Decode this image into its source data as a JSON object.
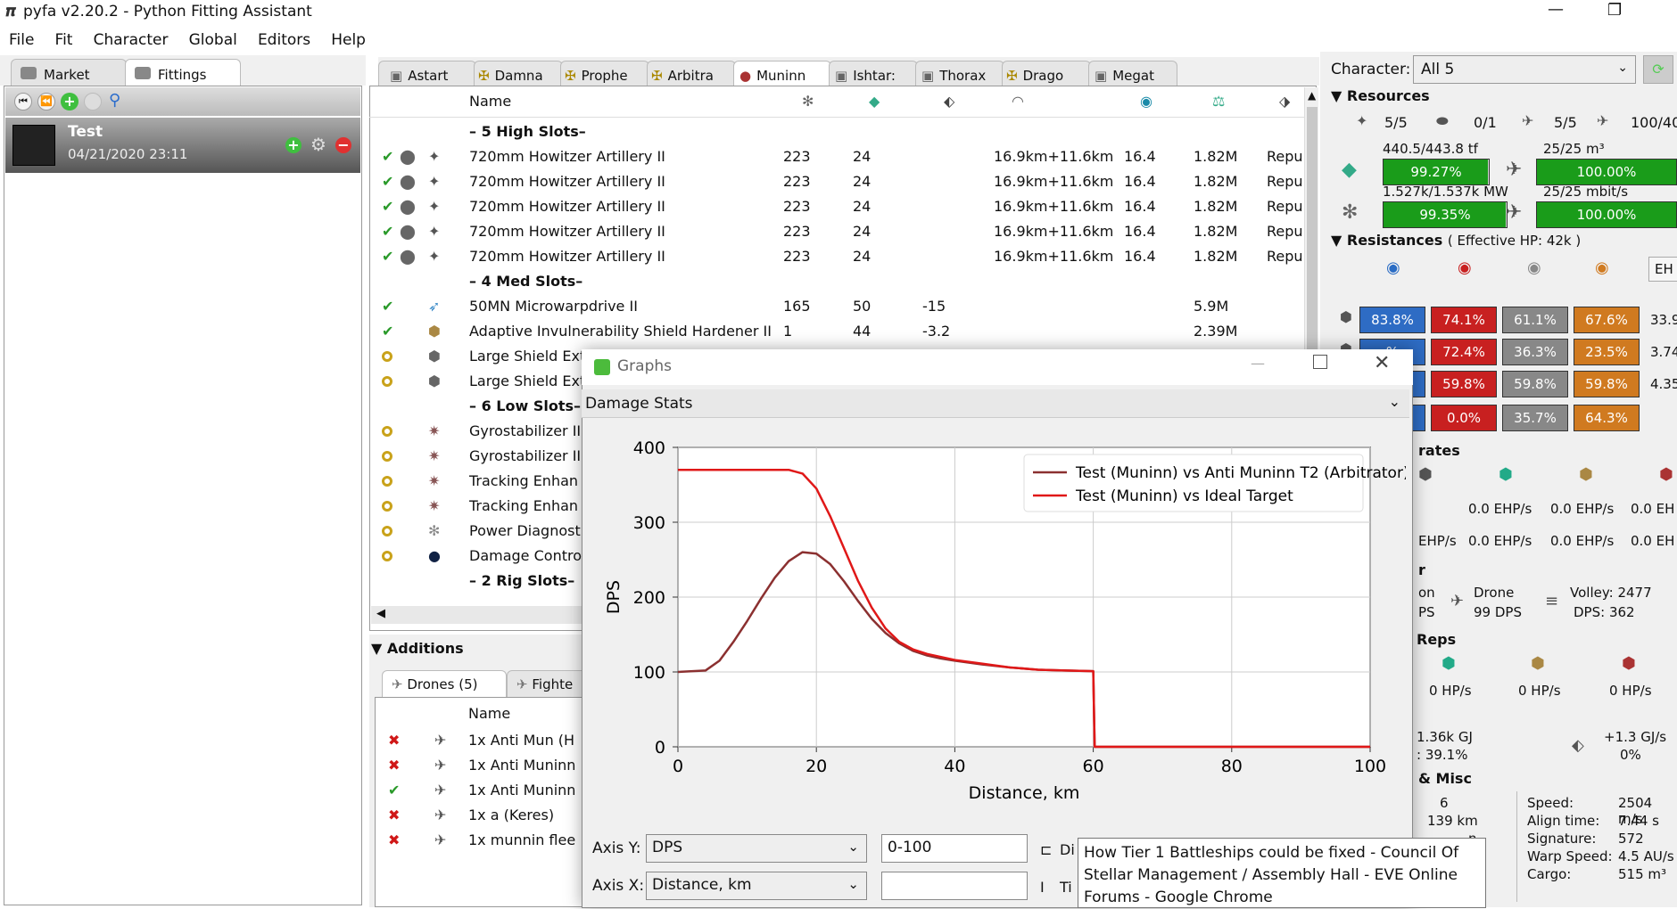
{
  "window": {
    "title": "pyfa v2.20.2 - Python Fitting Assistant"
  },
  "menu": [
    "File",
    "Fit",
    "Character",
    "Global",
    "Editors",
    "Help"
  ],
  "left_tabs": [
    "Market",
    "Fittings"
  ],
  "fit": {
    "name": "Test",
    "date": "04/21/2020 23:11"
  },
  "fit_tabs": [
    "Astart",
    "Damna",
    "Prophe",
    "Arbitra",
    "Muninn",
    "Ishtar:",
    "Thorax",
    "Drago",
    "Megat"
  ],
  "module_header": {
    "name": "Name"
  },
  "sections": {
    "high": "– 5 High Slots–",
    "med": "– 4 Med Slots–",
    "low": "– 6 Low Slots–",
    "rig": "– 2 Rig Slots–"
  },
  "high_modules": [
    {
      "name": "720mm Howitzer Artillery II",
      "c1": "223",
      "c2": "24",
      "range": "16.9km+11.6km",
      "c4": "16.4",
      "price": "1.82M",
      "extra": "Repu"
    },
    {
      "name": "720mm Howitzer Artillery II",
      "c1": "223",
      "c2": "24",
      "range": "16.9km+11.6km",
      "c4": "16.4",
      "price": "1.82M",
      "extra": "Repu"
    },
    {
      "name": "720mm Howitzer Artillery II",
      "c1": "223",
      "c2": "24",
      "range": "16.9km+11.6km",
      "c4": "16.4",
      "price": "1.82M",
      "extra": "Repu"
    },
    {
      "name": "720mm Howitzer Artillery II",
      "c1": "223",
      "c2": "24",
      "range": "16.9km+11.6km",
      "c4": "16.4",
      "price": "1.82M",
      "extra": "Repu"
    },
    {
      "name": "720mm Howitzer Artillery II",
      "c1": "223",
      "c2": "24",
      "range": "16.9km+11.6km",
      "c4": "16.4",
      "price": "1.82M",
      "extra": "Repu"
    }
  ],
  "med_modules": [
    {
      "name": "50MN Microwarpdrive II",
      "c1": "165",
      "c2": "50",
      "c3": "-15",
      "price": "5.9M"
    },
    {
      "name": "Adaptive Invulnerability Shield Hardener II",
      "c1": "1",
      "c2": "44",
      "c3": "-3.2",
      "price": "2.39M"
    },
    {
      "name": "Large Shield Ext"
    },
    {
      "name": "Large Shield Ext"
    }
  ],
  "low_modules": [
    "Gyrostabilizer II",
    "Gyrostabilizer II",
    "Tracking Enhan",
    "Tracking Enhan",
    "Power Diagnost",
    "Damage Contro"
  ],
  "additions": {
    "title": "Additions",
    "tabs": [
      "Drones (5)",
      "Fighte"
    ],
    "header": "Name",
    "items": [
      {
        "status": "x",
        "name": "1x Anti Mun (H"
      },
      {
        "status": "x",
        "name": "1x Anti Muninn"
      },
      {
        "status": "ok",
        "name": "1x Anti Muninn"
      },
      {
        "status": "x",
        "name": "1x a (Keres)"
      },
      {
        "status": "x",
        "name": "1x munnin flee"
      }
    ]
  },
  "character": {
    "label": "Character:",
    "value": "All 5"
  },
  "resources": {
    "title": "Resources",
    "slots": [
      "5/5",
      "0/1",
      "5/5",
      "100/40"
    ],
    "cpu_text": "440.5/443.8 tf",
    "cpu_pct": "99.27%",
    "cpu_fill": 0.9927,
    "drone_bay": "25/25 m³",
    "drone_pct": "100.00%",
    "pg_text": "1.527k/1.537k MW",
    "pg_pct": "99.35%",
    "pg_fill": 0.9935,
    "bandwidth": "25/25 mbit/s",
    "bw_pct": "100.00%"
  },
  "resistances": {
    "title": "Resistances",
    "ehp": "( Effective HP: 42k )",
    "ehp_col": "EH",
    "rows": [
      {
        "v": [
          "83.8%",
          "74.1%",
          "61.1%",
          "67.6%"
        ],
        "hp": "33.9"
      },
      {
        "v": [
          "%",
          "72.4%",
          "36.3%",
          "23.5%"
        ],
        "hp": "3.74"
      },
      {
        "v": [
          "%",
          "59.8%",
          "59.8%",
          "59.8%"
        ],
        "hp": "4.35"
      },
      {
        "v": [
          "",
          "0.0%",
          "35.7%",
          "64.3%"
        ],
        "hp": ""
      }
    ]
  },
  "rates": {
    "title": "rates",
    "r1": [
      "0.0 EHP/s",
      "0.0 EHP/s",
      "0.0 EH"
    ],
    "r2": [
      "EHP/s",
      "0.0 EHP/s",
      "0.0 EHP/s",
      "0.0 EH"
    ]
  },
  "firepower": {
    "a": "r",
    "b": "on",
    "c": "PS",
    "drone_label": "Drone",
    "drone_dps": "99 DPS",
    "volley": "Volley: 2477",
    "dps": "DPS: 362"
  },
  "reps": {
    "title": "Reps",
    "v": [
      "0 HP/s",
      "0 HP/s",
      "0 HP/s"
    ]
  },
  "cap": {
    "a": "1.36k GJ",
    "b": ": 39.1%",
    "rate": "+1.3 GJ/s",
    "pct": "0%"
  },
  "misc": {
    "title": "& Misc",
    "a": "6",
    "b": "139 km",
    "c": "n",
    "speed_l": "Speed:",
    "speed": "2504 m/s",
    "align_l": "Align time:",
    "align": "7.44 s",
    "sig_l": "Signature:",
    "sig": "572",
    "warp_l": "Warp Speed:",
    "warp": "4.5 AU/s",
    "cargo_l": "Cargo:",
    "cargo": "515 m³"
  },
  "graph_window": {
    "title": "Graphs",
    "dropdown": "Damage Stats",
    "axis_y_label": "Axis Y:",
    "axis_y": "DPS",
    "axis_x_label": "Axis X:",
    "axis_x": "Distance, km",
    "range": "0-100",
    "side1": "Di",
    "side2": "Ti"
  },
  "tooltip": "How Tier 1 Battleships could be fixed - Council Of Stellar Management / Assembly Hall - EVE Online Forums - Google Chrome",
  "chart_data": {
    "type": "line",
    "xlabel": "Distance, km",
    "ylabel": "DPS",
    "xlim": [
      0,
      100
    ],
    "ylim": [
      0,
      400
    ],
    "xticks": [
      0,
      20,
      40,
      60,
      80,
      100
    ],
    "yticks": [
      0,
      100,
      200,
      300,
      400
    ],
    "grid": true,
    "legend_position": "top-right",
    "series": [
      {
        "name": "Test (Muninn) vs Anti Muninn T2 (Arbitrator)",
        "color": "#8b3030",
        "x": [
          0,
          4,
          6,
          8,
          10,
          12,
          14,
          16,
          18,
          20,
          22,
          24,
          26,
          28,
          30,
          32,
          34,
          36,
          38,
          40,
          44,
          48,
          52,
          56,
          60,
          60.2,
          100
        ],
        "y": [
          100,
          102,
          115,
          140,
          168,
          198,
          226,
          248,
          260,
          258,
          244,
          221,
          195,
          171,
          152,
          138,
          128,
          122,
          118,
          115,
          110,
          106,
          103,
          102,
          101,
          0,
          0
        ]
      },
      {
        "name": "Test (Muninn) vs Ideal Target",
        "color": "#e01818",
        "x": [
          0,
          16,
          18,
          20,
          22,
          24,
          26,
          28,
          30,
          32,
          34,
          36,
          38,
          40,
          44,
          48,
          52,
          56,
          60,
          60.2,
          100
        ],
        "y": [
          370,
          370,
          365,
          345,
          308,
          265,
          222,
          186,
          158,
          140,
          130,
          124,
          120,
          116,
          111,
          106,
          103,
          102,
          101,
          0,
          0
        ]
      }
    ]
  }
}
